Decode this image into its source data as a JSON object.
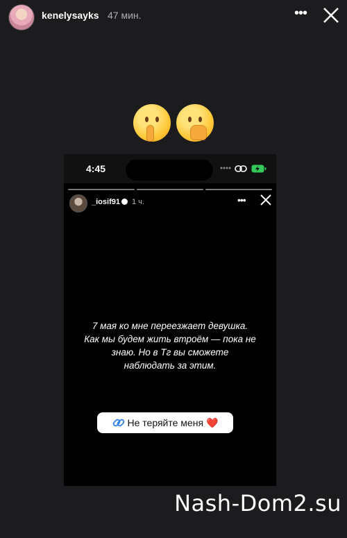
{
  "header": {
    "username": "kenelysayks",
    "time": "47 мин."
  },
  "inner_story": {
    "status_time": "4:45",
    "username": "_iosif91",
    "time": "1 ч.",
    "text_lines": [
      "7 мая ко мне переезжает девушка.",
      "Как мы будем жить втроём — пока не",
      "знаю. Но в Тг вы сможете",
      "наблюдать за этим."
    ],
    "link_label": "Не теряйте меня",
    "heart": "❤️"
  },
  "emojis": [
    "shushing-face",
    "hand-over-mouth-face"
  ],
  "watermark": "Nash-Dom2.su",
  "colors": {
    "background": "#1c1c1e",
    "battery": "#34c759"
  }
}
